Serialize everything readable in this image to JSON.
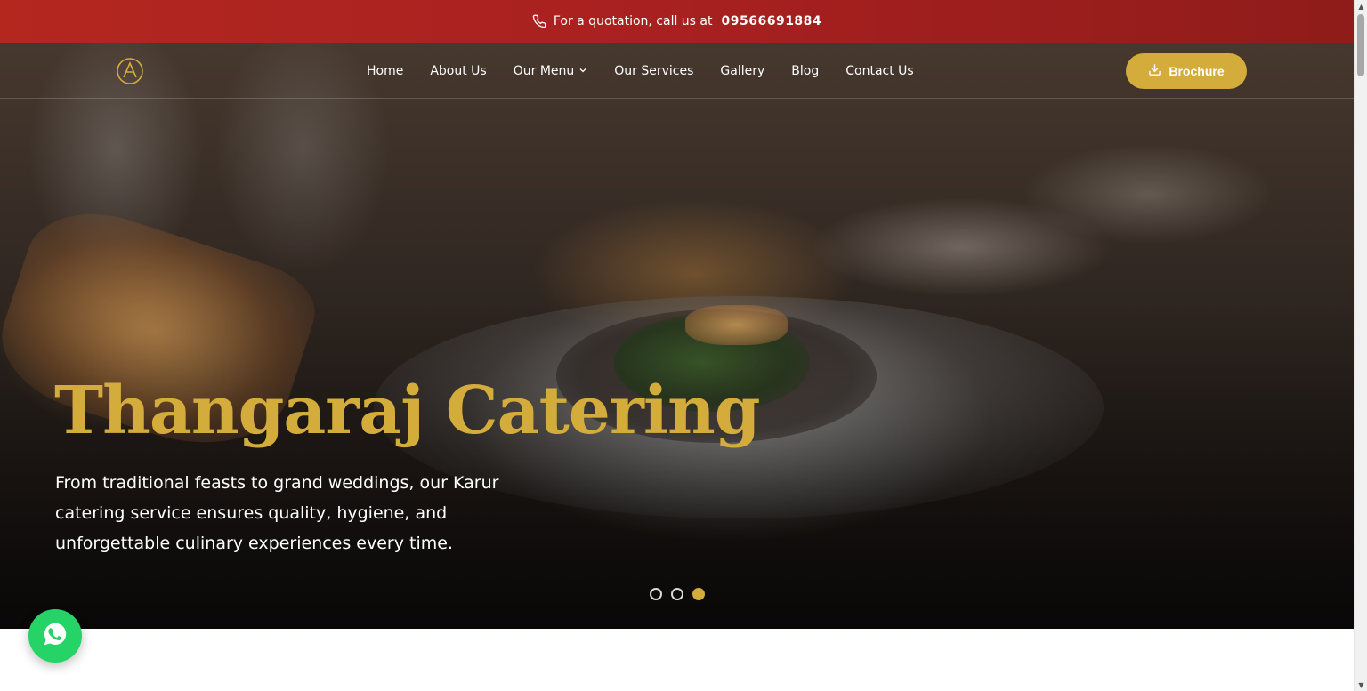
{
  "topbar": {
    "text": "For a quotation, call us at",
    "phone": "09566691884",
    "icon": "phone-icon"
  },
  "nav": {
    "logo": "logo-icon",
    "items": [
      {
        "label": "Home"
      },
      {
        "label": "About Us"
      },
      {
        "label": "Our Menu",
        "dropdown": true
      },
      {
        "label": "Our Services"
      },
      {
        "label": "Gallery"
      },
      {
        "label": "Blog"
      },
      {
        "label": "Contact Us"
      }
    ],
    "brochure_label": "Brochure",
    "brochure_icon": "download-icon"
  },
  "hero": {
    "title": "Thangaraj Catering",
    "description": "From traditional feasts to grand weddings, our Karur catering service ensures quality, hygiene, and unforgettable culinary experiences every time.",
    "slides": 3,
    "active_slide": 3
  },
  "colors": {
    "accent_gold": "#d4ac3c",
    "topbar_red": "#a82020",
    "whatsapp_green": "#25d366"
  },
  "floating": {
    "whatsapp_icon": "whatsapp-icon"
  }
}
